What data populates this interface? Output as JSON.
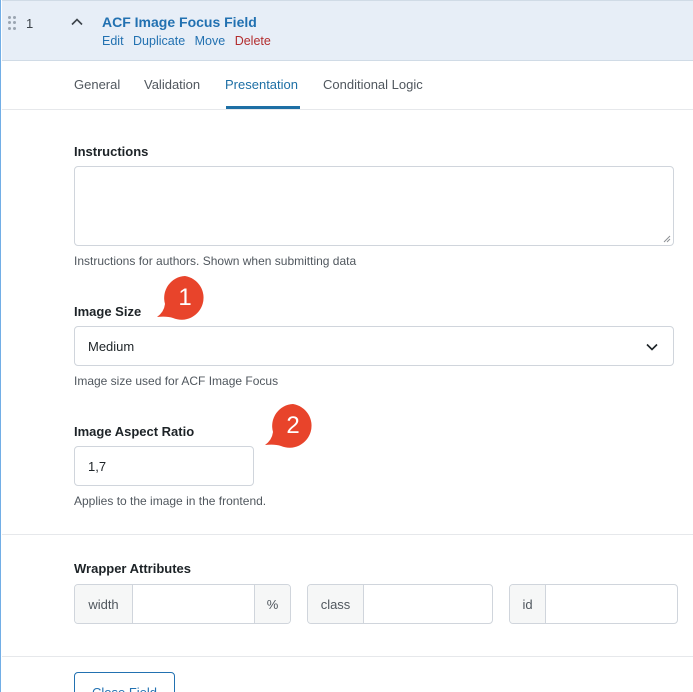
{
  "header": {
    "order": "1",
    "title": "ACF Image Focus Field",
    "actions": {
      "edit": "Edit",
      "duplicate": "Duplicate",
      "move": "Move",
      "delete": "Delete"
    }
  },
  "tabs": [
    {
      "label": "General",
      "active": false
    },
    {
      "label": "Validation",
      "active": false
    },
    {
      "label": "Presentation",
      "active": true
    },
    {
      "label": "Conditional Logic",
      "active": false
    }
  ],
  "instructions": {
    "label": "Instructions",
    "value": "",
    "description": "Instructions for authors. Shown when submitting data"
  },
  "image_size": {
    "label": "Image Size",
    "value": "Medium",
    "description": "Image size used for ACF Image Focus"
  },
  "aspect_ratio": {
    "label": "Image Aspect Ratio",
    "value": "1,7",
    "description": "Applies to the image in the frontend."
  },
  "wrapper": {
    "label": "Wrapper Attributes",
    "width_label": "width",
    "width_unit": "%",
    "class_label": "class",
    "id_label": "id"
  },
  "callouts": [
    "1",
    "2"
  ],
  "close_button": "Close Field",
  "colors": {
    "accent": "#2271b1",
    "delete": "#b32d2e",
    "callout": "#e8442b",
    "header_bg": "#e7eef7"
  }
}
